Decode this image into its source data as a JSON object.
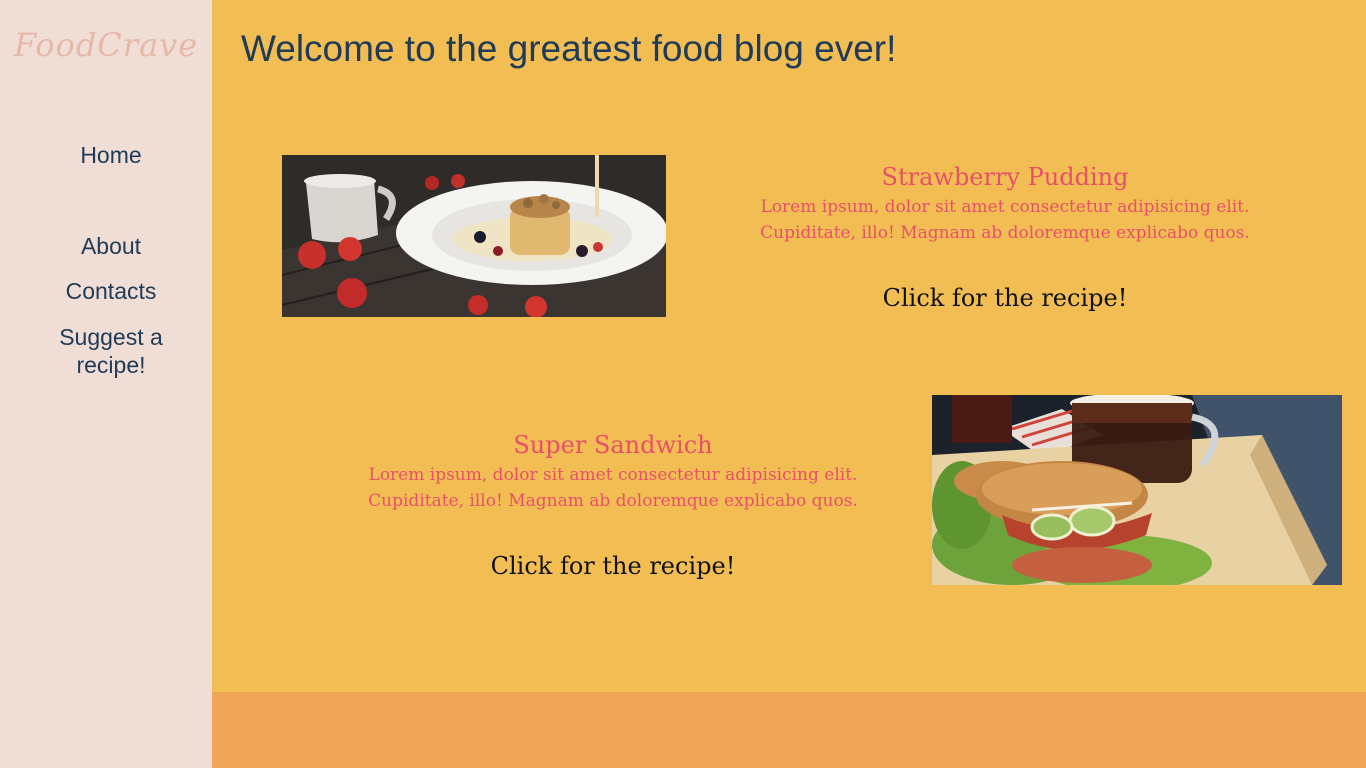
{
  "brand": {
    "logo_text": "FoodCrave"
  },
  "nav": {
    "items": [
      {
        "label": "Home"
      },
      {
        "label": "About"
      },
      {
        "label": "Contacts"
      },
      {
        "label": "Suggest a recipe!"
      }
    ]
  },
  "header": {
    "title": "Welcome to the greatest food blog ever!"
  },
  "recipes": [
    {
      "title": "Strawberry Pudding",
      "description_line1": "Lorem ipsum, dolor sit amet consectetur adipisicing elit.",
      "description_line2": "Cupiditate, illo! Magnam ab doloremque explicabo quos.",
      "link_label": "Click for the recipe!"
    },
    {
      "title": "Super Sandwich",
      "description_line1": "Lorem ipsum, dolor sit amet consectetur adipisicing elit.",
      "description_line2": "Cupiditate, illo! Magnam ab doloremque explicabo quos.",
      "link_label": "Click for the recipe!"
    }
  ],
  "colors": {
    "sidebar_bg": "#f0ddd5",
    "main_bg": "#f2bd53",
    "footer_bg": "#f0a656",
    "heading_text": "#1f3b57",
    "recipe_accent": "#e8506a",
    "logo": "#e5b8a8"
  },
  "icons": {
    "photo_1": "strawberry-pudding-photo",
    "photo_2": "sandwich-and-coffee-photo"
  }
}
